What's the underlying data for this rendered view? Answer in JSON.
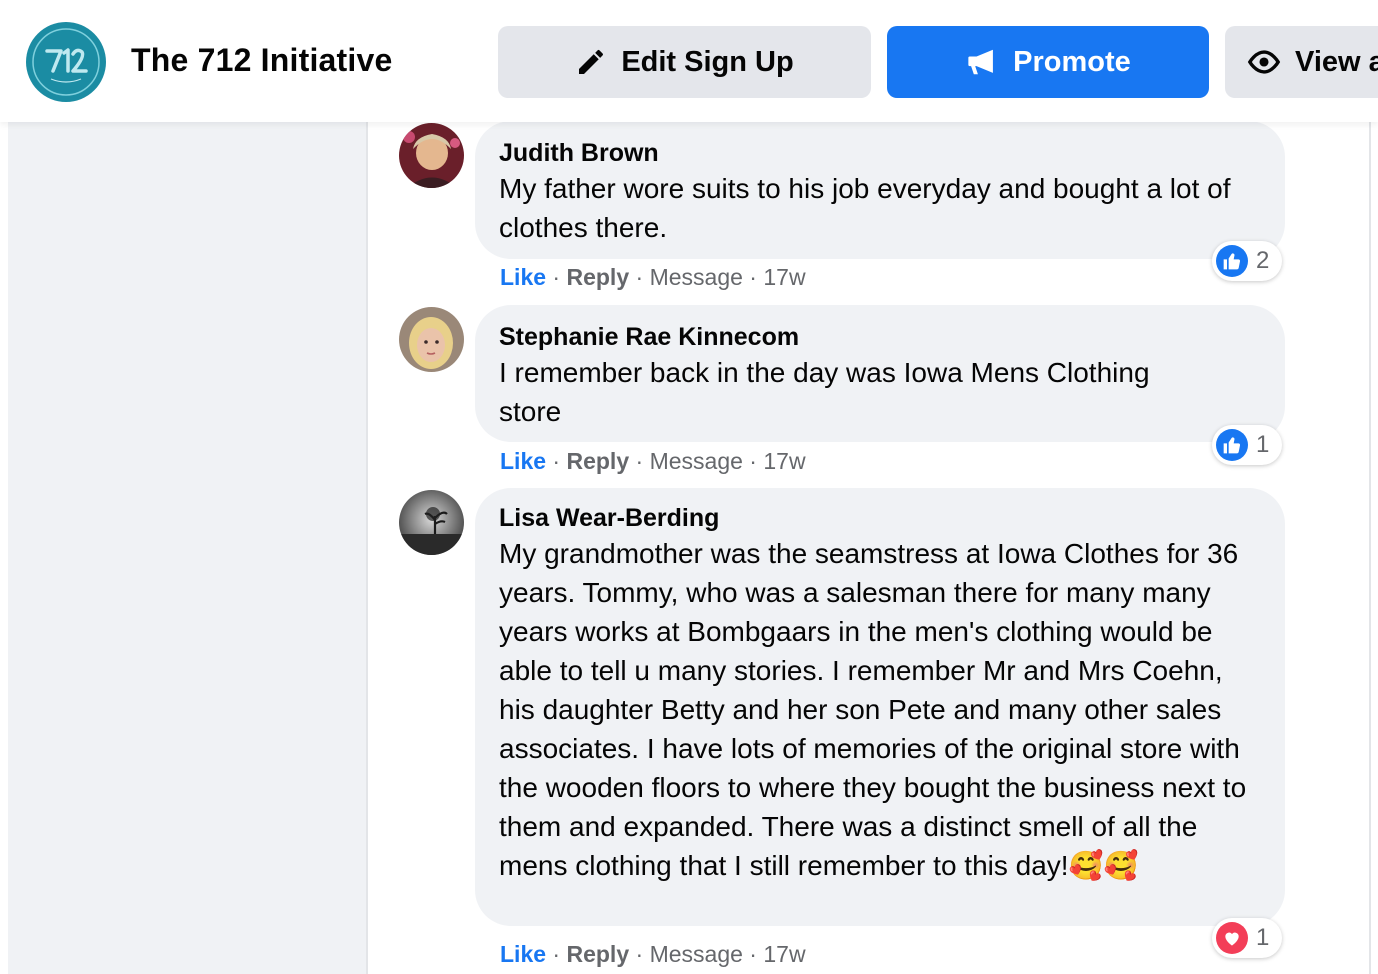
{
  "header": {
    "page_name": "The 712 Initiative",
    "logo_text": "THE 712 INITIATIVE",
    "buttons": {
      "edit": "Edit Sign Up",
      "promote": "Promote",
      "view": "View a"
    },
    "colors": {
      "promote_bg": "#1877f2",
      "secondary_bg": "#e4e6eb",
      "logo_bg": "#1b8ca3"
    }
  },
  "comments": [
    {
      "author": "Judith Brown",
      "text": "My father wore suits to his job everyday and bought a lot of clothes there.",
      "actions": {
        "like": "Like",
        "reply": "Reply",
        "message": "Message",
        "time": "17w"
      },
      "reaction": {
        "type": "like-icon",
        "count": "2"
      }
    },
    {
      "author": "Stephanie Rae Kinnecom",
      "text": "I remember back in the day was Iowa Mens Clothing store",
      "actions": {
        "like": "Like",
        "reply": "Reply",
        "message": "Message",
        "time": "17w"
      },
      "reaction": {
        "type": "like-icon",
        "count": "1"
      }
    },
    {
      "author": "Lisa Wear-Berding",
      "text": "My grandmother was the seamstress at Iowa Clothes for 36 years. Tommy, who was a salesman there for many many years works at Bombgaars in the men's clothing would be able to tell u many stories. I remember Mr and Mrs Coehn, his daughter Betty and her son Pete and many other sales associates. I have lots of memories of the original store with the wooden floors to where they bought the business next to them and expanded. There was a distinct smell of all the mens clothing that I still remember to this day!",
      "emoji": "🥰🥰",
      "actions": {
        "like": "Like",
        "reply": "Reply",
        "message": "Message",
        "time": "17w"
      },
      "reaction": {
        "type": "love-icon",
        "count": "1"
      }
    }
  ],
  "separator": " · "
}
